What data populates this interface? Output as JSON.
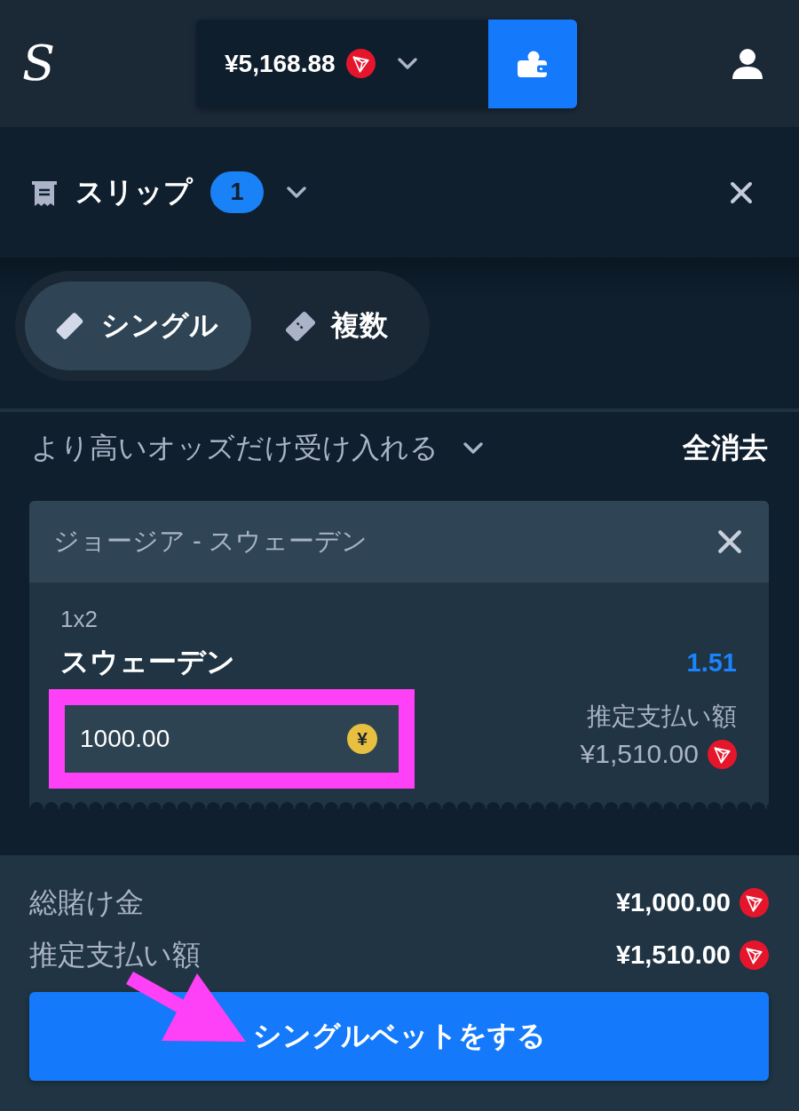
{
  "top_bar": {
    "logo": "S",
    "balance": "¥5,168.88"
  },
  "slip_header": {
    "title": "スリップ",
    "count": "1"
  },
  "bet_types": [
    {
      "kind": "single",
      "label": "シングル",
      "selected": true
    },
    {
      "kind": "multiple",
      "label": "複数",
      "selected": false
    }
  ],
  "odds_option": {
    "label": "より高いオッズだけ受け入れる"
  },
  "clear_all": "全消去",
  "bets": [
    {
      "event": "ジョージア - スウェーデン",
      "market": "1x2",
      "selection": "スウェーデン",
      "odds": "1.51",
      "stake": {
        "value": "1000.00",
        "currency": "¥",
        "highlighted": true
      },
      "payout_label": "推定支払い額",
      "payout": "¥1,510.00"
    }
  ],
  "summary": [
    {
      "label": "総賭け金",
      "value": "¥1,000.00"
    },
    {
      "label": "推定支払い額",
      "value": "¥1,510.00"
    }
  ],
  "place_bet_button": {
    "label": "シングルベットをする",
    "pointer_arrow": true
  }
}
